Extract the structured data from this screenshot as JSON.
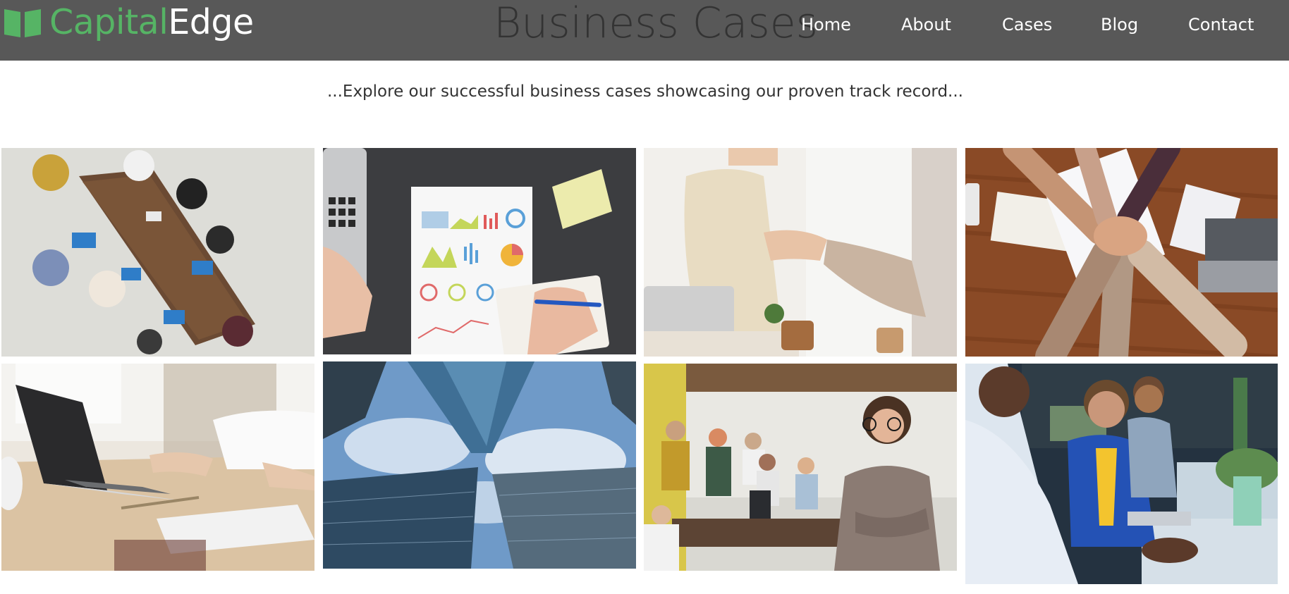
{
  "brand": {
    "name_part1": "Capital",
    "name_part2": "Edge",
    "accent_color": "#56b465",
    "icon": "open-book-icon"
  },
  "header": {
    "page_title": "Business Cases",
    "background_color": "#585858"
  },
  "nav": {
    "items": [
      {
        "label": "Home"
      },
      {
        "label": "About"
      },
      {
        "label": "Cases"
      },
      {
        "label": "Blog"
      },
      {
        "label": "Contact"
      }
    ]
  },
  "main": {
    "tagline": "...Explore our successful business cases showcasing our proven track record...",
    "gallery": [
      {
        "subject": "team-meeting-overhead-photo"
      },
      {
        "subject": "charts-and-notes-photo"
      },
      {
        "subject": "handshake-photo"
      },
      {
        "subject": "hands-together-photo"
      },
      {
        "subject": "laptop-typing-photo"
      },
      {
        "subject": "skyscrapers-photo"
      },
      {
        "subject": "office-team-portrait-photo"
      },
      {
        "subject": "colleagues-at-desks-photo"
      }
    ]
  }
}
